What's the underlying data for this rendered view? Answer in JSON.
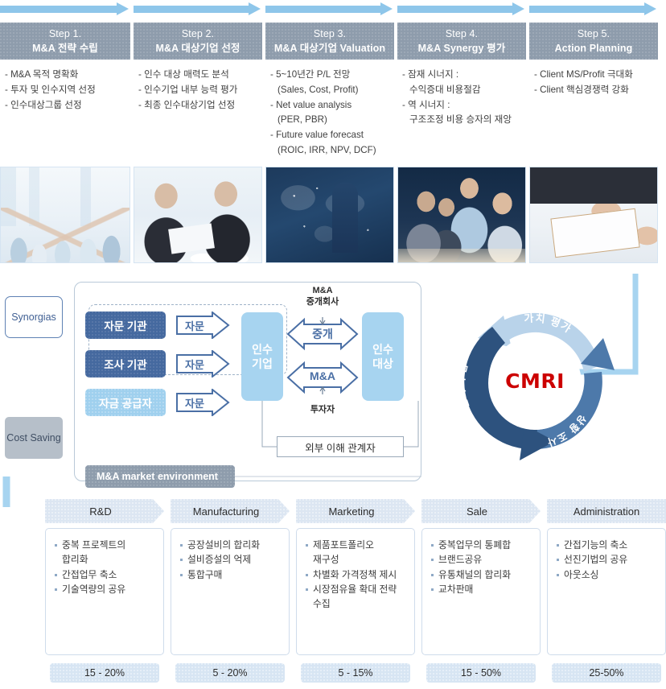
{
  "top_flow": {
    "steps": [
      {
        "number": "Step 1.",
        "title": "M&A 전략 수립",
        "items": [
          {
            "text": "- M&A 목적 명확화",
            "sub": false
          },
          {
            "text": "- 투자 및 인수지역 선정",
            "sub": false
          },
          {
            "text": "- 인수대상그룹 선정",
            "sub": false
          }
        ]
      },
      {
        "number": "Step 2.",
        "title": "M&A 대상기업 선정",
        "items": [
          {
            "text": "- 인수 대상 매력도 분석",
            "sub": false
          },
          {
            "text": "- 인수기업 내부 능력 평가",
            "sub": false
          },
          {
            "text": "- 최종 인수대상기업 선정",
            "sub": false
          }
        ]
      },
      {
        "number": "Step 3.",
        "title": "M&A 대상기업 Valuation",
        "items": [
          {
            "text": "- 5~10년간 P/L 전망",
            "sub": false
          },
          {
            "text": "(Sales, Cost, Profit)",
            "sub": true
          },
          {
            "text": "- Net value analysis",
            "sub": false
          },
          {
            "text": "(PER, PBR)",
            "sub": true
          },
          {
            "text": "- Future value forecast",
            "sub": false
          },
          {
            "text": "(ROIC, IRR, NPV, DCF)",
            "sub": true
          }
        ]
      },
      {
        "number": "Step 4.",
        "title": "M&A Synergy 평가",
        "items": [
          {
            "text": "- 잠재 시너지 :",
            "sub": false
          },
          {
            "text": "수익증대 비용절감",
            "sub": true
          },
          {
            "text": "- 역 시너지 :",
            "sub": false
          },
          {
            "text": "구조조정 비용 승자의 재앙",
            "sub": true
          }
        ]
      },
      {
        "number": "Step 5.",
        "title": "Action Planning",
        "items": [
          {
            "text": "- Client MS/Profit 극대화",
            "sub": false
          },
          {
            "text": "- Client 핵심경쟁력 강화",
            "sub": false
          }
        ]
      }
    ]
  },
  "photos": [
    {
      "name": "team-high-five-photo"
    },
    {
      "name": "business-meeting-photo"
    },
    {
      "name": "global-map-silhouette-photo"
    },
    {
      "name": "conference-discussion-photo"
    },
    {
      "name": "document-review-photo"
    }
  ],
  "middle_diagram": {
    "side_tags": {
      "synergies": "Synorgias",
      "cost_saving": "Cost Saving"
    },
    "environment_label": "M&A market environment",
    "org_boxes": [
      {
        "label": "자문 기관",
        "style": "dark"
      },
      {
        "label": "조사 기관",
        "style": "dark"
      },
      {
        "label": "자금 공급자",
        "style": "light"
      }
    ],
    "advice_arrows": [
      "자문",
      "자문",
      "자문"
    ],
    "parties": {
      "acquirer_line1": "인수",
      "acquirer_line2": "기업",
      "target_line1": "인수",
      "target_line2": "대상"
    },
    "relations": [
      {
        "label": "중개",
        "caption": "M&A\n중개회사"
      },
      {
        "label": "M&A",
        "caption": "투자자"
      }
    ],
    "broker_caption_line1": "M&A",
    "broker_caption_line2": "중개회사",
    "investor_caption": "투자자",
    "stakeholder_box": "외부 이해 관계자"
  },
  "cmri_cycle": {
    "center_label": "CMRI",
    "segments": [
      {
        "label": "가치 평가",
        "position": "top",
        "color": "#b9d3ea"
      },
      {
        "label": "상황 조사",
        "position": "bottom-right",
        "color": "#4d79aa"
      },
      {
        "label": "전략 수립",
        "position": "left",
        "color": "#2d527e"
      }
    ]
  },
  "bottom_flow": {
    "columns": [
      {
        "header": "R&D",
        "items": [
          {
            "text": "중복 프로젝트의",
            "bullet": true
          },
          {
            "text": "합리화",
            "bullet": false
          },
          {
            "text": "간접업무 축소",
            "bullet": true
          },
          {
            "text": "기술역량의 공유",
            "bullet": true
          }
        ],
        "percent": "15 - 20%"
      },
      {
        "header": "Manufacturing",
        "items": [
          {
            "text": "공장설비의 합리화",
            "bullet": true
          },
          {
            "text": "설비증설의 억제",
            "bullet": true
          },
          {
            "text": "통합구매",
            "bullet": true
          }
        ],
        "percent": "5 - 20%"
      },
      {
        "header": "Marketing",
        "items": [
          {
            "text": "제품포트폴리오",
            "bullet": true
          },
          {
            "text": "재구성",
            "bullet": false
          },
          {
            "text": "차별화 가격정책 제시",
            "bullet": true
          },
          {
            "text": "시장점유율 확대 전략",
            "bullet": true
          },
          {
            "text": "수집",
            "bullet": false
          }
        ],
        "percent": "5 - 15%"
      },
      {
        "header": "Sale",
        "items": [
          {
            "text": "중복업무의 통폐합",
            "bullet": true
          },
          {
            "text": "브랜드공유",
            "bullet": true
          },
          {
            "text": "유통채널의 합리화",
            "bullet": true
          },
          {
            "text": "교차판매",
            "bullet": true
          }
        ],
        "percent": "15 - 50%"
      },
      {
        "header": "Administration",
        "items": [
          {
            "text": "간접기능의 축소",
            "bullet": true
          },
          {
            "text": "선진기법의 공유",
            "bullet": true
          },
          {
            "text": "아웃소싱",
            "bullet": true
          }
        ],
        "percent": "25-50%"
      }
    ]
  },
  "colors": {
    "arrow_blue": "#8ec6ea",
    "step_header_gray": "#8e9cac",
    "org_dark_blue": "#45699f",
    "org_light_blue": "#9fd0ee",
    "party_blue": "#a7d4f0",
    "cmri_red": "#cc0000",
    "fn_header_blue": "#dce6f2",
    "fn_pct_blue": "#d7e5f3"
  }
}
